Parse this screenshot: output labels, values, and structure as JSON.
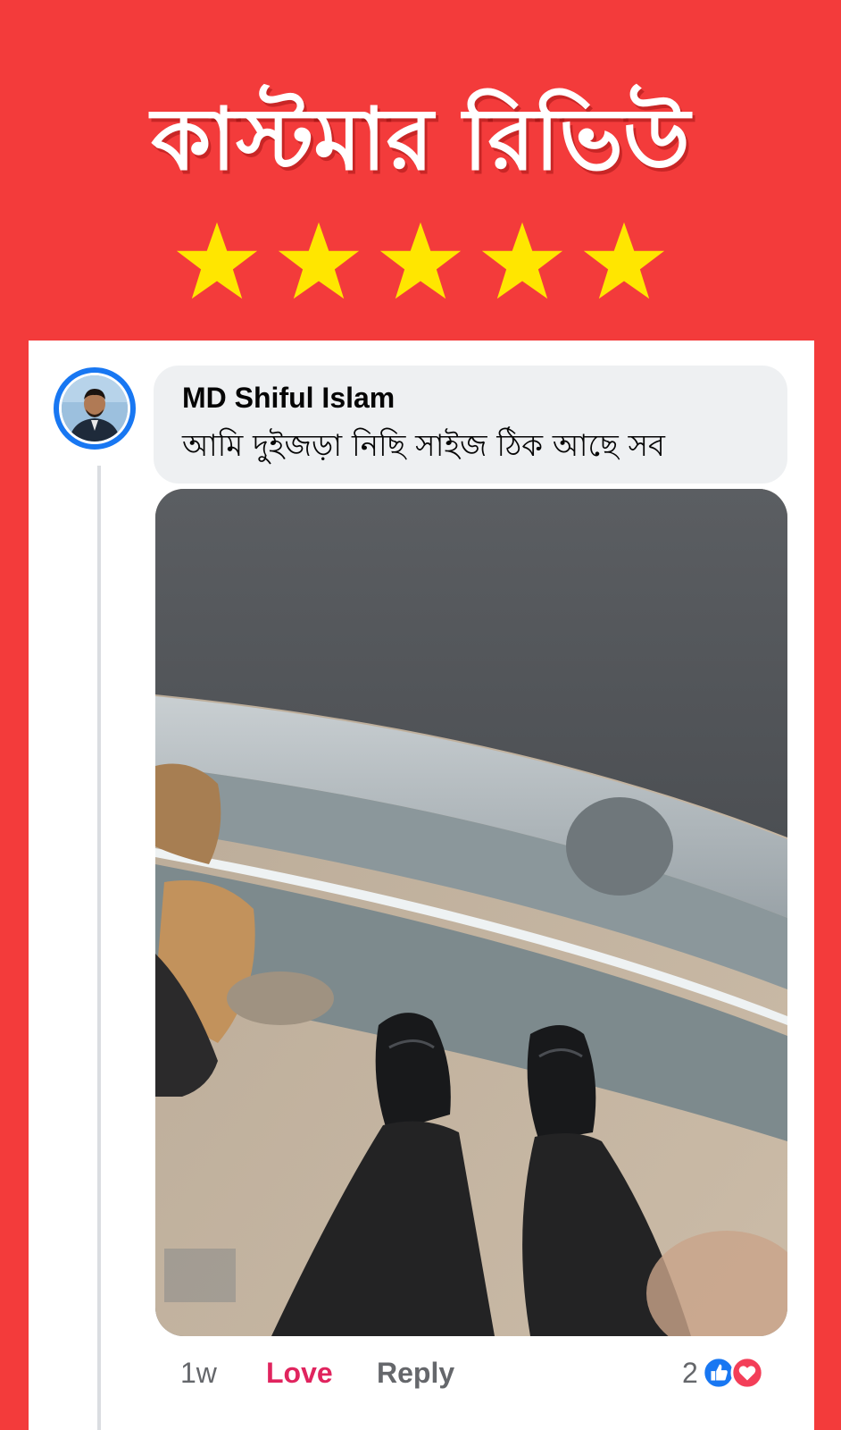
{
  "banner": {
    "title": "কাস্টমার রিভিউ",
    "rating": 5,
    "star_color": "#ffe600"
  },
  "comment": {
    "author": "MD Shiful Islam",
    "text": "আমি দুইজড়া নিছি সাইজ ঠিক আছে সব",
    "timestamp": "1w",
    "love_label": "Love",
    "reply_label": "Reply",
    "reaction_count": "2",
    "reactions": [
      "like-icon",
      "love-icon"
    ]
  },
  "colors": {
    "background": "#f33b3b",
    "accent": "#1877f2",
    "love": "#e0245e"
  }
}
